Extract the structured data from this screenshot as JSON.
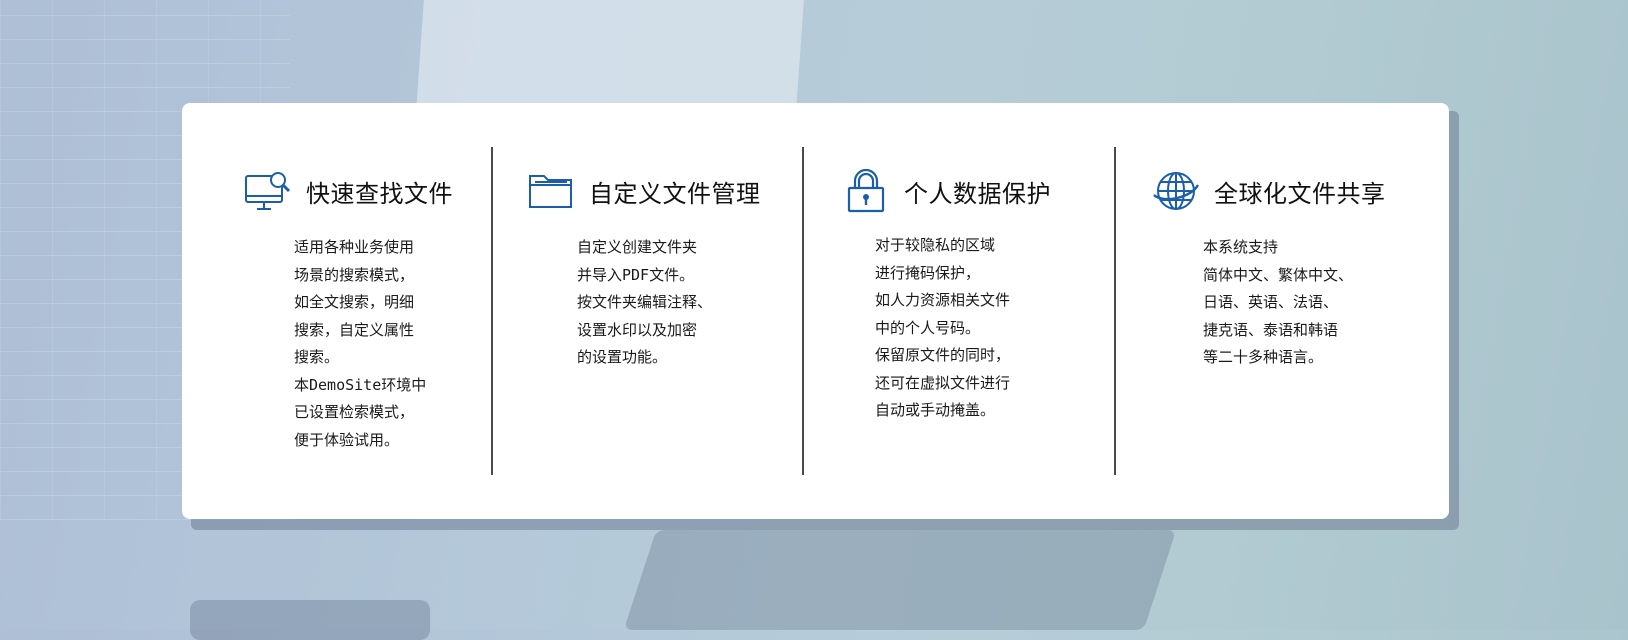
{
  "features": [
    {
      "icon": "monitor-search-icon",
      "title": "快速查找文件",
      "lines": [
        "适用各种业务使用",
        "场景的搜索模式，",
        "如全文搜索，明细",
        "搜索，自定义属性",
        "搜索。",
        "本DemoSite环境中",
        "已设置检索模式，",
        "便于体验试用。"
      ]
    },
    {
      "icon": "folder-icon",
      "title": "自定义文件管理",
      "lines": [
        "自定义创建文件夹",
        "并导入PDF文件。",
        "按文件夹编辑注释、",
        "设置水印以及加密",
        "的设置功能。"
      ]
    },
    {
      "icon": "lock-icon",
      "title": "个人数据保护",
      "lines": [
        "对于较隐私的区域",
        "进行掩码保护，",
        "如人力资源相关文件",
        "中的个人号码。",
        "保留原文件的同时，",
        "还可在虚拟文件进行",
        "自动或手动掩盖。"
      ]
    },
    {
      "icon": "globe-icon",
      "title": "全球化文件共享",
      "lines": [
        "本系统支持",
        "简体中文、繁体中文、",
        "日语、英语、法语、",
        "捷克语、泰语和韩语",
        "等二十多种语言。"
      ]
    }
  ],
  "colors": {
    "icon_blue": "#1a5fa8",
    "title_text": "#111111",
    "divider": "#4a4a4a",
    "card_bg": "#ffffff"
  }
}
